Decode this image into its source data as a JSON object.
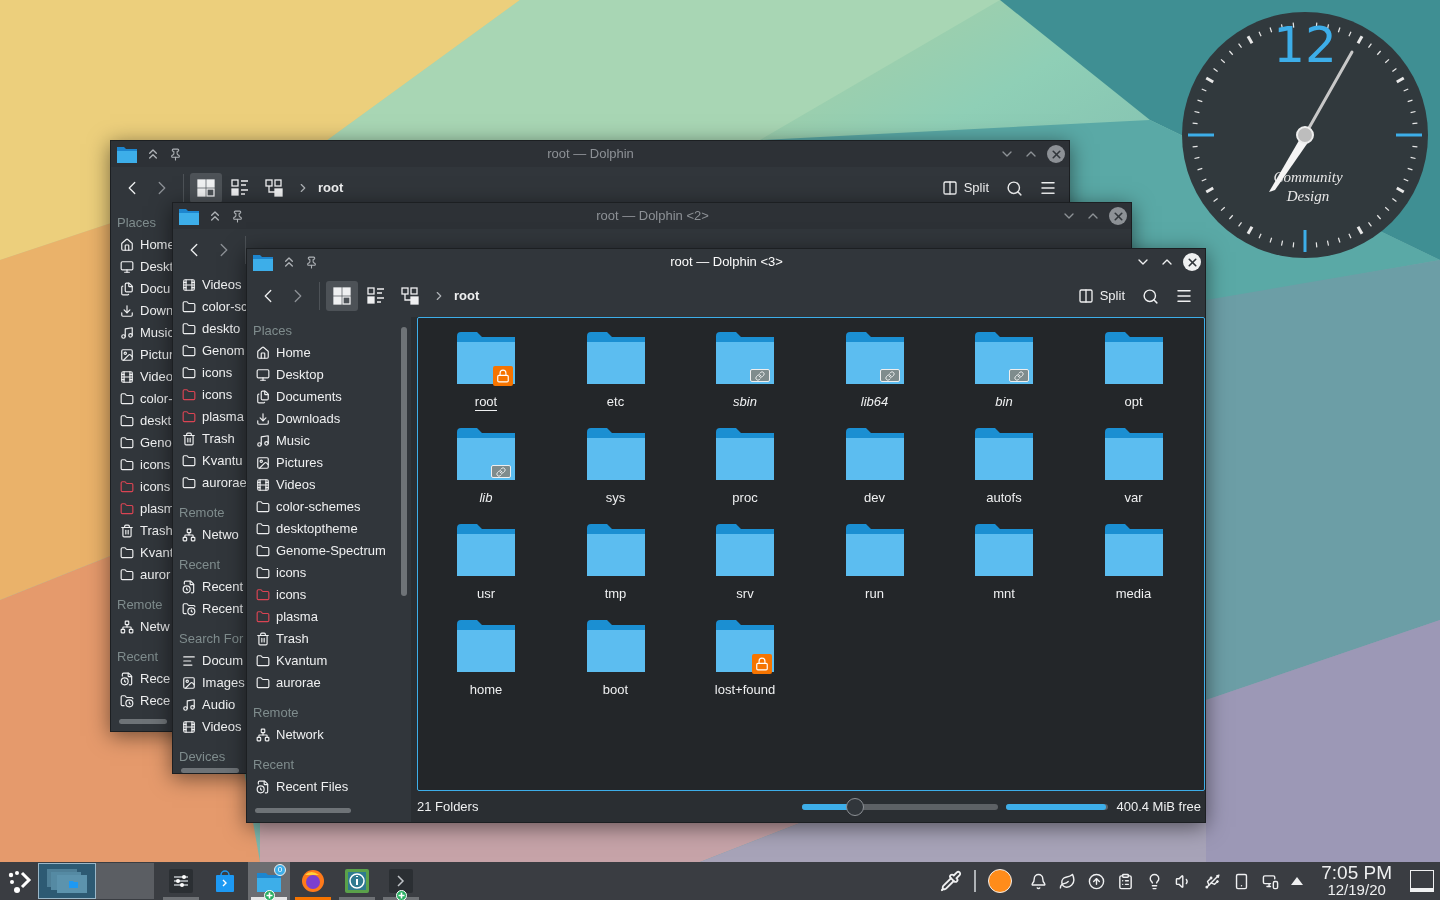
{
  "clock": {
    "numeral": "12",
    "brand": [
      "Community",
      "Design"
    ]
  },
  "windows": [
    {
      "title": "root — Dolphin",
      "active": false,
      "view_modes": [
        {
          "kind": "icons",
          "selected": true
        },
        {
          "kind": "details",
          "selected": false
        },
        {
          "kind": "tree",
          "selected": false
        }
      ],
      "breadcrumb": "root",
      "split_label": "Split",
      "sidebar": [
        {
          "heading": "Places",
          "items": [
            {
              "kind": "home",
              "label": "Home"
            },
            {
              "kind": "desktop",
              "label": "Deskt"
            },
            {
              "kind": "documents",
              "label": "Docu"
            },
            {
              "kind": "downloads",
              "label": "Down"
            },
            {
              "kind": "music",
              "label": "Music"
            },
            {
              "kind": "pictures",
              "label": "Pictur"
            },
            {
              "kind": "videos",
              "label": "Video"
            },
            {
              "kind": "folder",
              "label": "color-"
            },
            {
              "kind": "folder",
              "label": "deskt"
            },
            {
              "kind": "folder",
              "label": "Geno"
            },
            {
              "kind": "folder",
              "label": "icons"
            },
            {
              "kind": "folder",
              "label": "icons",
              "color": "#da4453"
            },
            {
              "kind": "folder",
              "label": "plasm",
              "color": "#da4453"
            },
            {
              "kind": "trash",
              "label": "Trash"
            },
            {
              "kind": "folder",
              "label": "Kvant"
            },
            {
              "kind": "folder",
              "label": "auror"
            }
          ]
        },
        {
          "heading": "Remote",
          "items": [
            {
              "kind": "network",
              "label": "Netw"
            }
          ]
        },
        {
          "heading": "Recent",
          "items": [
            {
              "kind": "recent-files",
              "label": "Rece"
            },
            {
              "kind": "recent-locations",
              "label": "Rece"
            }
          ]
        }
      ]
    },
    {
      "title": "root — Dolphin <2>",
      "active": false,
      "sidebar": [
        {
          "items": [
            {
              "kind": "videos",
              "label": "Videos"
            },
            {
              "kind": "folder",
              "label": "color-sc"
            },
            {
              "kind": "folder",
              "label": "deskto"
            },
            {
              "kind": "folder",
              "label": "Genom"
            },
            {
              "kind": "folder",
              "label": "icons"
            },
            {
              "kind": "folder",
              "label": "icons",
              "color": "#da4453"
            },
            {
              "kind": "folder",
              "label": "plasma",
              "color": "#da4453"
            },
            {
              "kind": "trash",
              "label": "Trash"
            },
            {
              "kind": "folder",
              "label": "Kvantu"
            },
            {
              "kind": "folder",
              "label": "aurorae"
            }
          ]
        },
        {
          "heading": "Remote",
          "items": [
            {
              "kind": "network",
              "label": "Netwo"
            }
          ]
        },
        {
          "heading": "Recent",
          "items": [
            {
              "kind": "recent-files",
              "label": "Recent"
            },
            {
              "kind": "recent-locations",
              "label": "Recent"
            }
          ]
        },
        {
          "heading": "Search For",
          "items": [
            {
              "kind": "text",
              "label": "Docum"
            },
            {
              "kind": "pictures",
              "label": "Images"
            },
            {
              "kind": "music",
              "label": "Audio"
            },
            {
              "kind": "videos",
              "label": "Videos"
            }
          ]
        },
        {
          "heading": "Devices"
        }
      ]
    },
    {
      "title": "root — Dolphin <3>",
      "active": true,
      "view_modes": [
        {
          "kind": "icons",
          "selected": true
        },
        {
          "kind": "details",
          "selected": false
        },
        {
          "kind": "tree",
          "selected": false
        }
      ],
      "breadcrumb": "root",
      "split_label": "Split",
      "sidebar": [
        {
          "heading": "Places",
          "items": [
            {
              "kind": "home",
              "label": "Home"
            },
            {
              "kind": "desktop",
              "label": "Desktop"
            },
            {
              "kind": "documents",
              "label": "Documents"
            },
            {
              "kind": "downloads",
              "label": "Downloads"
            },
            {
              "kind": "music",
              "label": "Music"
            },
            {
              "kind": "pictures",
              "label": "Pictures"
            },
            {
              "kind": "videos",
              "label": "Videos"
            },
            {
              "kind": "folder",
              "label": "color-schemes"
            },
            {
              "kind": "folder",
              "label": "desktoptheme"
            },
            {
              "kind": "folder",
              "label": "Genome-Spectrum"
            },
            {
              "kind": "folder",
              "label": "icons"
            },
            {
              "kind": "folder",
              "label": "icons",
              "color": "#da4453"
            },
            {
              "kind": "folder",
              "label": "plasma",
              "color": "#da4453"
            },
            {
              "kind": "trash",
              "label": "Trash"
            },
            {
              "kind": "folder",
              "label": "Kvantum"
            },
            {
              "kind": "folder",
              "label": "aurorae"
            }
          ]
        },
        {
          "heading": "Remote",
          "items": [
            {
              "kind": "network",
              "label": "Network"
            }
          ]
        },
        {
          "heading": "Recent",
          "items": [
            {
              "kind": "recent-files",
              "label": "Recent Files"
            }
          ]
        }
      ],
      "folders": [
        {
          "name": "root",
          "kind": "locked",
          "focused": true
        },
        {
          "name": "etc",
          "kind": "plain",
          "focused": false
        },
        {
          "name": "sbin",
          "kind": "symlink",
          "focused": false
        },
        {
          "name": "lib64",
          "kind": "symlink",
          "focused": false
        },
        {
          "name": "bin",
          "kind": "symlink",
          "focused": false
        },
        {
          "name": "opt",
          "kind": "plain",
          "focused": false
        },
        {
          "name": "lib",
          "kind": "symlink",
          "focused": false
        },
        {
          "name": "sys",
          "kind": "plain",
          "focused": false
        },
        {
          "name": "proc",
          "kind": "plain",
          "focused": false
        },
        {
          "name": "dev",
          "kind": "plain",
          "focused": false
        },
        {
          "name": "autofs",
          "kind": "plain",
          "focused": false
        },
        {
          "name": "var",
          "kind": "plain",
          "focused": false
        },
        {
          "name": "usr",
          "kind": "plain",
          "focused": false
        },
        {
          "name": "tmp",
          "kind": "plain",
          "focused": false
        },
        {
          "name": "srv",
          "kind": "plain",
          "focused": false
        },
        {
          "name": "run",
          "kind": "plain",
          "focused": false
        },
        {
          "name": "mnt",
          "kind": "plain",
          "focused": false
        },
        {
          "name": "media",
          "kind": "plain",
          "focused": false
        },
        {
          "name": "home",
          "kind": "plain",
          "focused": false
        },
        {
          "name": "boot",
          "kind": "plain",
          "focused": false
        },
        {
          "name": "lost+found",
          "kind": "locked",
          "focused": false
        }
      ],
      "status": {
        "count": "21 Folders",
        "zoom": {
          "level": 0.27
        },
        "free_space": {
          "level": 0.98,
          "label": "400.4 MiB free"
        }
      }
    }
  ],
  "taskbar": {
    "desktops": [
      {
        "selected": true
      },
      {
        "selected": false
      }
    ],
    "tasks": [
      {
        "kind": "settings",
        "running": true,
        "active": false,
        "attention": false,
        "plus": false
      },
      {
        "kind": "store",
        "running": false,
        "active": false,
        "attention": false,
        "plus": false
      },
      {
        "kind": "files",
        "running": true,
        "active": true,
        "attention": false,
        "plus": true,
        "badge": "0"
      },
      {
        "kind": "browser",
        "running": true,
        "active": false,
        "attention": true,
        "plus": false
      },
      {
        "kind": "info",
        "running": true,
        "active": false,
        "attention": false,
        "plus": false
      },
      {
        "kind": "terminal",
        "running": true,
        "active": false,
        "attention": false,
        "plus": true
      }
    ],
    "time": "7:05 PM",
    "date": "12/19/20"
  }
}
